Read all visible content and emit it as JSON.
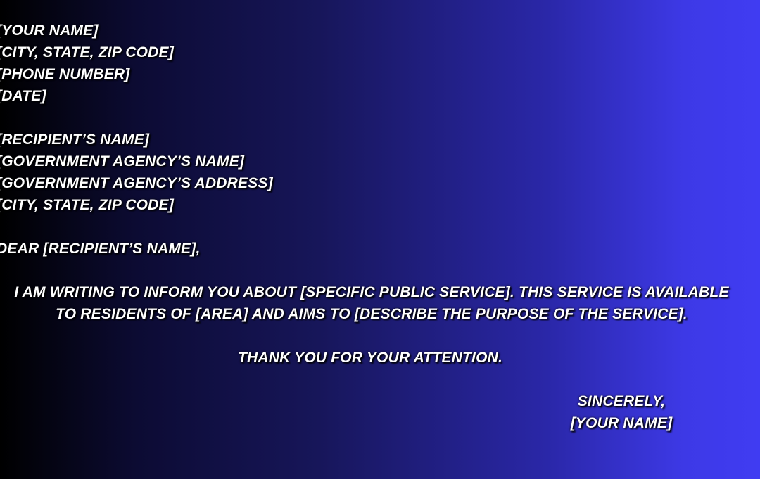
{
  "sender": {
    "name": "[YOUR NAME]",
    "city_state_zip": "[CITY, STATE, ZIP CODE]",
    "phone": "[PHONE NUMBER]",
    "date": "[DATE]"
  },
  "recipient": {
    "name": "[RECIPIENT’S NAME]",
    "agency_name": "[GOVERNMENT AGENCY’S NAME]",
    "agency_address": "[GOVERNMENT AGENCY’S ADDRESS]",
    "city_state_zip": "[CITY, STATE, ZIP CODE]"
  },
  "salutation": "DEAR [RECIPIENT’S NAME],",
  "body": {
    "line1": "I AM WRITING TO INFORM YOU ABOUT [SPECIFIC PUBLIC SERVICE]. THIS SERVICE IS AVAILABLE",
    "line2": "TO RESIDENTS OF [AREA] AND AIMS TO [DESCRIBE THE PURPOSE OF THE SERVICE]."
  },
  "thanks": "THANK YOU FOR YOUR ATTENTION.",
  "closing": {
    "valediction": "SINCERELY,",
    "signature": "[YOUR NAME]"
  },
  "colors": {
    "gradient_start": "#000000",
    "gradient_end": "#403cf2",
    "text": "#ffffff"
  }
}
